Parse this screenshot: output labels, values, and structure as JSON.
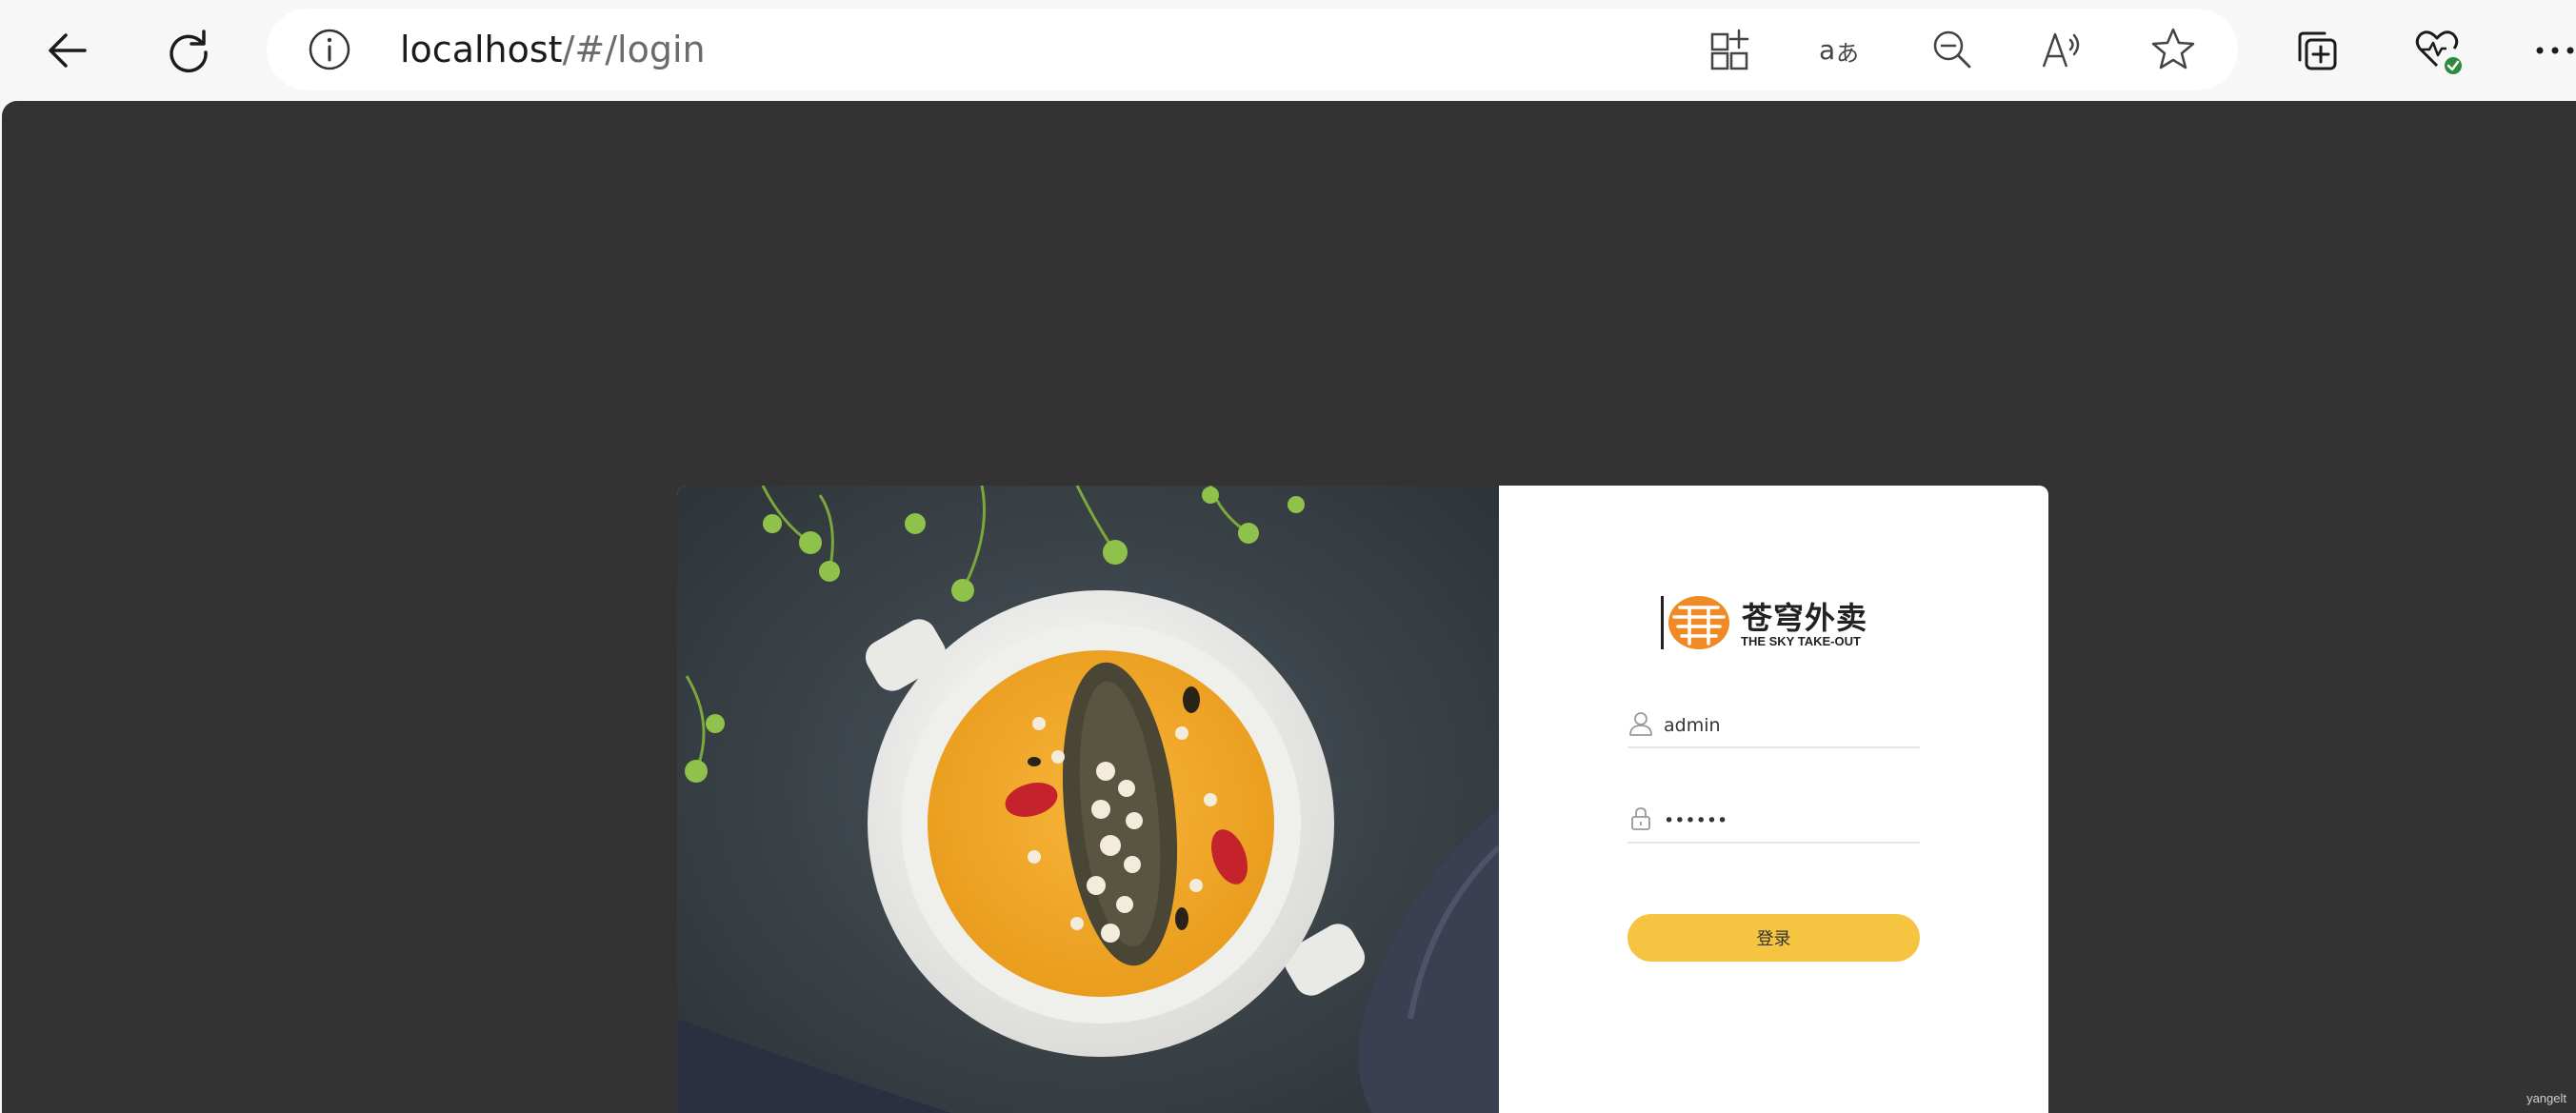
{
  "browser": {
    "url_host": "localhost",
    "url_path": "/#/login"
  },
  "login": {
    "logo_cn": "苍穹外卖",
    "logo_en": "THE SKY TAKE-OUT",
    "username_value": "admin",
    "password_value": "123456",
    "submit_label": "登录"
  },
  "watermark": "yangelt",
  "colors": {
    "page_bg": "#333333",
    "accent": "#f5c542",
    "logo_orange": "#f08a24"
  }
}
